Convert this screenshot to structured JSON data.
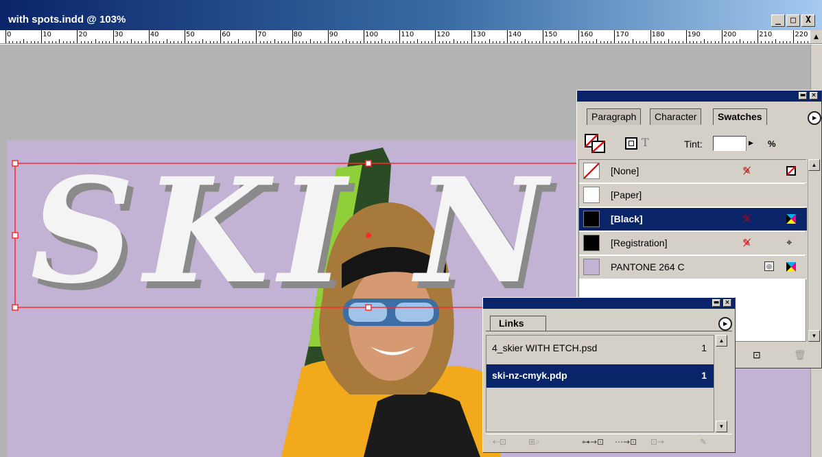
{
  "document": {
    "title": "with spots.indd @ 103%",
    "window_buttons": {
      "minimize": "_",
      "maximize": "□",
      "close": "X"
    }
  },
  "ruler": {
    "labels": [
      "0",
      "10",
      "20",
      "30",
      "40",
      "50",
      "60",
      "70",
      "80",
      "90",
      "100",
      "110",
      "120",
      "130",
      "140",
      "150",
      "160",
      "170",
      "180",
      "190",
      "200",
      "210",
      "220"
    ]
  },
  "artwork": {
    "headline_text": "SKI N",
    "background_color": "#c2b2d4"
  },
  "swatches_palette": {
    "tabs": [
      {
        "label": "Paragraph",
        "active": false
      },
      {
        "label": "Character",
        "active": false
      },
      {
        "label": "Swatches",
        "active": true
      }
    ],
    "tint_label": "Tint:",
    "tint_value": "",
    "tint_unit": "%",
    "swatches": [
      {
        "name": "[None]",
        "color": "#ffffff",
        "selected": false,
        "icon1": "no-edit-icon",
        "icon2": "none-icon"
      },
      {
        "name": "[Paper]",
        "color": "#ffffff",
        "selected": false,
        "icon1": "",
        "icon2": ""
      },
      {
        "name": "[Black]",
        "color": "#000000",
        "selected": true,
        "icon1": "no-edit-icon",
        "icon2": "cmyk-icon"
      },
      {
        "name": "[Registration]",
        "color": "#000000",
        "selected": false,
        "icon1": "no-edit-icon",
        "icon2": "registration-icon"
      },
      {
        "name": "PANTONE 264 C",
        "color": "#c2b2d4",
        "selected": false,
        "icon1": "spot-color-icon",
        "icon2": "cmyk-icon"
      }
    ]
  },
  "links_palette": {
    "tab_label": "Links",
    "links": [
      {
        "name": "4_skier WITH ETCH.psd",
        "page": "1",
        "selected": false
      },
      {
        "name": "ski-nz-cmyk.pdp",
        "page": "1",
        "selected": true
      }
    ]
  }
}
